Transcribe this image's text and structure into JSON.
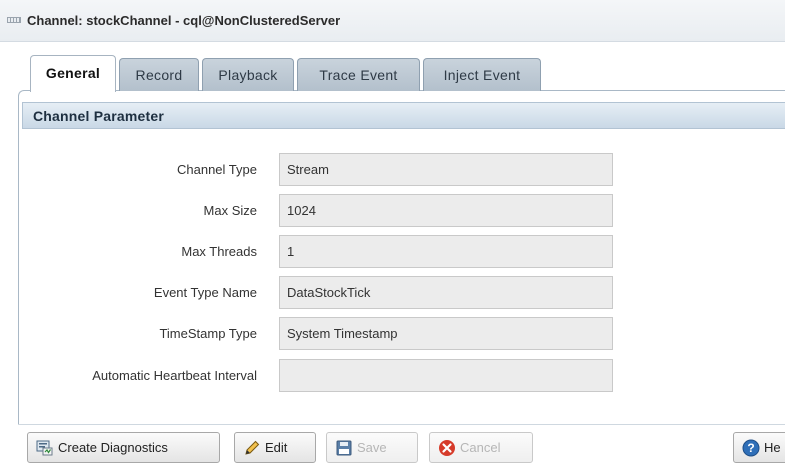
{
  "window": {
    "title": "Channel: stockChannel - cql@NonClusteredServer"
  },
  "tabs": [
    {
      "label": "General",
      "active": true
    },
    {
      "label": "Record",
      "active": false
    },
    {
      "label": "Playback",
      "active": false
    },
    {
      "label": "Trace Event",
      "active": false
    },
    {
      "label": "Inject Event",
      "active": false
    }
  ],
  "section": {
    "title": "Channel Parameter"
  },
  "fields": [
    {
      "label": "Channel Type",
      "value": "Stream"
    },
    {
      "label": "Max Size",
      "value": "1024"
    },
    {
      "label": "Max Threads",
      "value": "1"
    },
    {
      "label": "Event Type Name",
      "value": "DataStockTick"
    },
    {
      "label": "TimeStamp Type",
      "value": "System Timestamp"
    },
    {
      "label": "Automatic Heartbeat Interval",
      "value": ""
    }
  ],
  "buttons": {
    "create_diagnostics": "Create Diagnostics",
    "edit": "Edit",
    "save": "Save",
    "cancel": "Cancel",
    "help": "He"
  },
  "icons": {
    "grip": "grip-icon",
    "create_diagnostics": "diagnostics-icon",
    "edit": "pencil-icon",
    "save": "floppy-icon",
    "cancel": "cancel-icon",
    "help": "help-icon"
  },
  "colors": {
    "section_header": "#c9d8e6",
    "field_bg": "#ececec",
    "cancel_red": "#d63b2a",
    "help_blue": "#2f6fb8"
  }
}
